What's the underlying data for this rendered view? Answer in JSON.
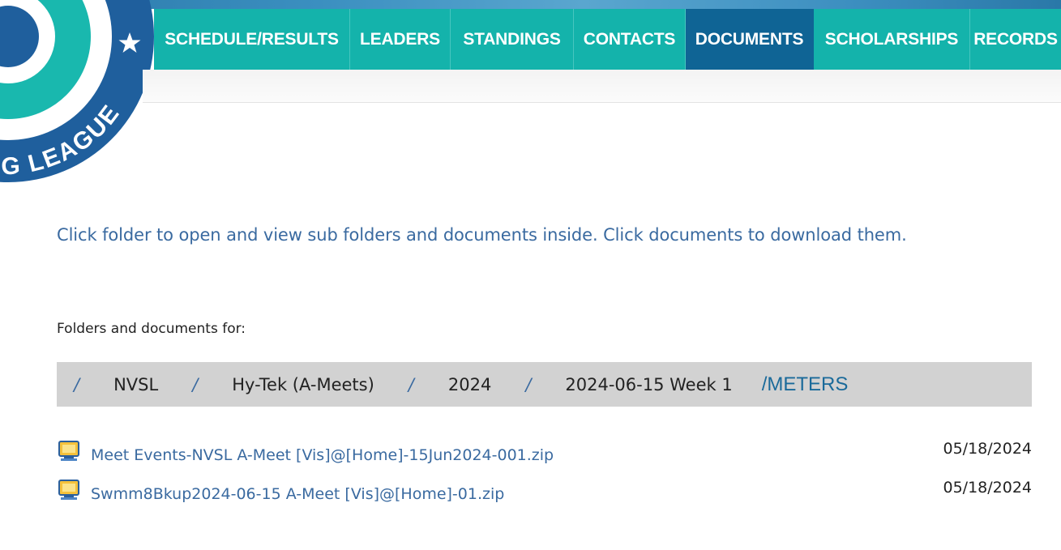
{
  "header": {
    "nav_items": [
      {
        "label": "SCHEDULE/RESULTS",
        "active": false
      },
      {
        "label": "LEADERS",
        "active": false
      },
      {
        "label": "STANDINGS",
        "active": false
      },
      {
        "label": "CONTACTS",
        "active": false
      },
      {
        "label": "DOCUMENTS",
        "active": true
      },
      {
        "label": "SCHOLARSHIPS",
        "active": false
      },
      {
        "label": "RECORDS",
        "active": false
      }
    ],
    "logo_text": "G LEAGUE"
  },
  "main": {
    "intro_text": "Click folder to open and view sub folders and documents inside. Click documents to download them.",
    "folders_label": "Folders and documents for:",
    "breadcrumb": {
      "separator": "/",
      "items": [
        "NVSL",
        "Hy-Tek (A-Meets)",
        "2024",
        "2024-06-15 Week 1"
      ],
      "current": "/METERS"
    },
    "documents": [
      {
        "name": "Meet Events-NVSL A-Meet [Vis]@[Home]-15Jun2024-001.zip",
        "date": "05/18/2024"
      },
      {
        "name": "Swmm8Bkup2024-06-15 A-Meet [Vis]@[Home]-01.zip",
        "date": "05/18/2024"
      }
    ]
  },
  "colors": {
    "nav_bg": "#14b3ab",
    "nav_active": "#0f6495",
    "link": "#3a6aa0",
    "breadcrumb_bg": "#d2d2d2",
    "logo_blue": "#1f5f9d",
    "logo_teal": "#19b8ae"
  },
  "icons": {
    "logo": "league-logo",
    "document": "zip-document-icon"
  }
}
